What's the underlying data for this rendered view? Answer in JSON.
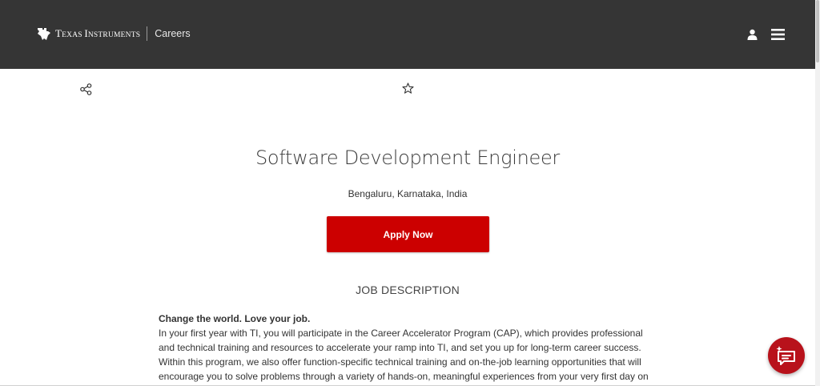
{
  "header": {
    "brand_name_1": "T",
    "brand_name_2": "EXAS ",
    "brand_name_3": "I",
    "brand_name_4": "NSTRUMENTS",
    "careers_label": "Careers",
    "icons": {
      "logo": "ti-logo-icon",
      "user": "user-icon",
      "menu": "hamburger-menu-icon"
    }
  },
  "toolbar": {
    "share_icon": "share-icon",
    "favorite_icon": "star-icon"
  },
  "job": {
    "title": "Software Development Engineer",
    "location": "Bengaluru, Karnataka, India",
    "apply_label": "Apply Now"
  },
  "description": {
    "heading": "JOB DESCRIPTION",
    "lead": "Change the world. Love your job.",
    "body": "In your first year with TI, you will participate in the Career Accelerator Program (CAP), which provides professional and technical training and resources to accelerate your ramp into TI, and set you up for long-term career success. Within this program, we also offer function-specific technical training and on-the-job learning opportunities that will encourage you to solve problems through a variety of hands-on, meaningful experiences from your very first day on"
  },
  "chat": {
    "icon": "chat-assistant-icon"
  },
  "colors": {
    "header_bg": "#353535",
    "accent_red": "#cc0000",
    "chat_red": "#b8121b"
  }
}
